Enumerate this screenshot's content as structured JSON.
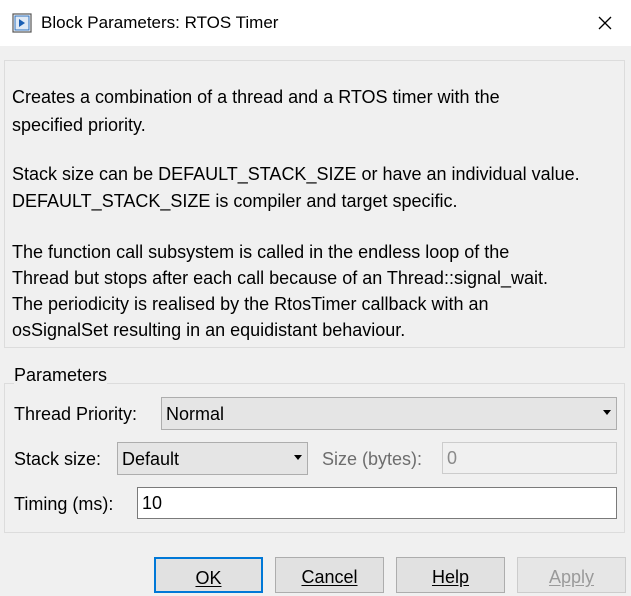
{
  "window": {
    "title": "Block Parameters: RTOS Timer",
    "icons": [
      "simulink-block-icon",
      "close-icon"
    ]
  },
  "description": {
    "lines": [
      "Creates a combination of a thread and a RTOS timer with the",
      "specified priority.",
      "Stack size can be DEFAULT_STACK_SIZE or have an individual value.",
      "DEFAULT_STACK_SIZE is compiler and target specific.",
      "The function call subsystem is called in the endless loop of the",
      "Thread but stops after each call because of an Thread::signal_wait.",
      "The periodicity is realised by the RtosTimer callback with an",
      "osSignalSet resulting in an equidistant behaviour."
    ]
  },
  "parameters": {
    "group_label": "Parameters",
    "thread_priority": {
      "label": "Thread Priority:",
      "value": "Normal"
    },
    "stack_size": {
      "label": "Stack size:",
      "value": "Default"
    },
    "size_bytes": {
      "label": "Size (bytes):",
      "value": "0"
    },
    "timing": {
      "label": "Timing (ms):",
      "value": "10"
    }
  },
  "buttons": {
    "ok": "OK",
    "cancel": "Cancel",
    "help": "Help",
    "apply": "Apply"
  }
}
